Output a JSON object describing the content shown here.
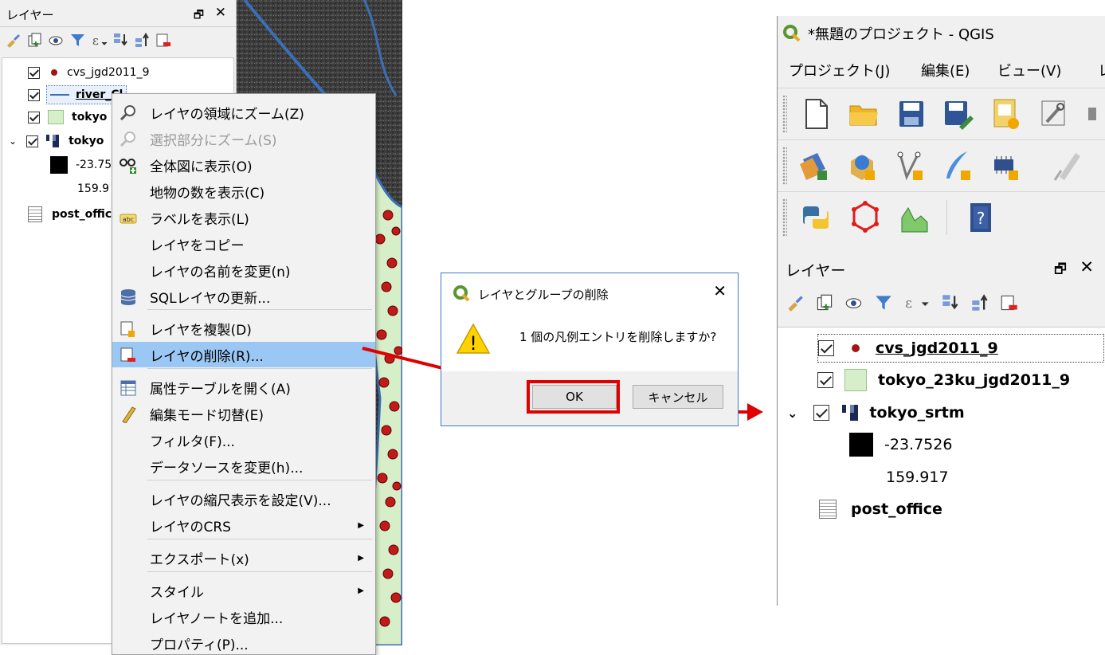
{
  "left_panel": {
    "title": "レイヤー",
    "float_icon": "🗗",
    "close_icon": "✕",
    "layers": [
      {
        "name": "cvs_jgd2011_9",
        "symbol": "red-dot"
      },
      {
        "name": "river_Clip",
        "visible_text": "river_Cl",
        "symbol": "blue-line"
      },
      {
        "name": "tokyo",
        "symbol": "green-polygon"
      },
      {
        "name": "tokyo",
        "symbol": "raster"
      },
      {
        "name": "-23.75",
        "symbol": "black-square"
      },
      {
        "name": "159.9",
        "symbol": "none"
      },
      {
        "name": "post_offic",
        "symbol": "table"
      }
    ]
  },
  "context_menu": {
    "items": [
      {
        "label": "レイヤの領域にズーム(Z)",
        "icon": "zoom-icon"
      },
      {
        "label": "選択部分にズーム(S)",
        "icon": "zoom-selection-icon",
        "disabled": true
      },
      {
        "label": "全体図に表示(O)",
        "icon": "overview-icon"
      },
      {
        "label": "地物の数を表示(C)",
        "icon": ""
      },
      {
        "label": "ラベルを表示(L)",
        "icon": "label-icon",
        "icon_text": "abc"
      },
      {
        "label": "レイヤをコピー",
        "icon": ""
      },
      {
        "label": "レイヤの名前を変更(n)",
        "icon": ""
      },
      {
        "label": "SQLレイヤの更新...",
        "icon": "database-icon"
      },
      {
        "label": "レイヤを複製(D)",
        "icon": "duplicate-icon"
      },
      {
        "label": "レイヤの削除(R)...",
        "icon": "remove-layer-icon",
        "selected": true
      },
      {
        "label": "属性テーブルを開く(A)",
        "icon": "attribute-table-icon"
      },
      {
        "label": "編集モード切替(E)",
        "icon": "pencil-icon"
      },
      {
        "label": "フィルタ(F)...",
        "icon": ""
      },
      {
        "label": "データソースを変更(h)...",
        "icon": ""
      },
      {
        "label": "レイヤの縮尺表示を設定(V)...",
        "icon": ""
      },
      {
        "label": "レイヤのCRS",
        "icon": "",
        "submenu": true
      },
      {
        "label": "エクスポート(x)",
        "icon": "",
        "submenu": true
      },
      {
        "label": "スタイル",
        "icon": "",
        "submenu": true
      },
      {
        "label": "レイヤノートを追加...",
        "icon": ""
      },
      {
        "label": "プロパティ(P)...",
        "icon": ""
      }
    ],
    "submenu_arrow": "▶"
  },
  "dialog": {
    "title": "レイヤとグループの削除",
    "message": "1 個の凡例エントリを削除しますか?",
    "ok_label": "OK",
    "cancel_label": "キャンセル",
    "close_glyph": "✕",
    "warning_glyph": "!"
  },
  "qgis_window": {
    "title": "*無題のプロジェクト - QGIS",
    "menu": [
      "プロジェクト(J)",
      "編集(E)",
      "ビュー(V)",
      "レ"
    ],
    "panel_title": "レイヤー",
    "float_icon": "🗗",
    "close_icon": "✕",
    "layers": [
      {
        "name": "cvs_jgd2011_9",
        "symbol": "red-dot"
      },
      {
        "name": "tokyo_23ku_jgd2011_9",
        "symbol": "green-polygon"
      },
      {
        "name": "tokyo_srtm",
        "symbol": "raster",
        "expanded": true
      },
      {
        "name": "-23.7526",
        "symbol": "black-square"
      },
      {
        "name": "159.917",
        "symbol": "none"
      },
      {
        "name": "post_office",
        "symbol": "table"
      }
    ],
    "help_glyph": "?"
  },
  "colors": {
    "accent_red": "#e00000",
    "selection_blue": "#9ac7f3",
    "river_blue": "#3b6fb6",
    "point_red": "#a31515",
    "polygon_fill": "#d6efc9"
  }
}
